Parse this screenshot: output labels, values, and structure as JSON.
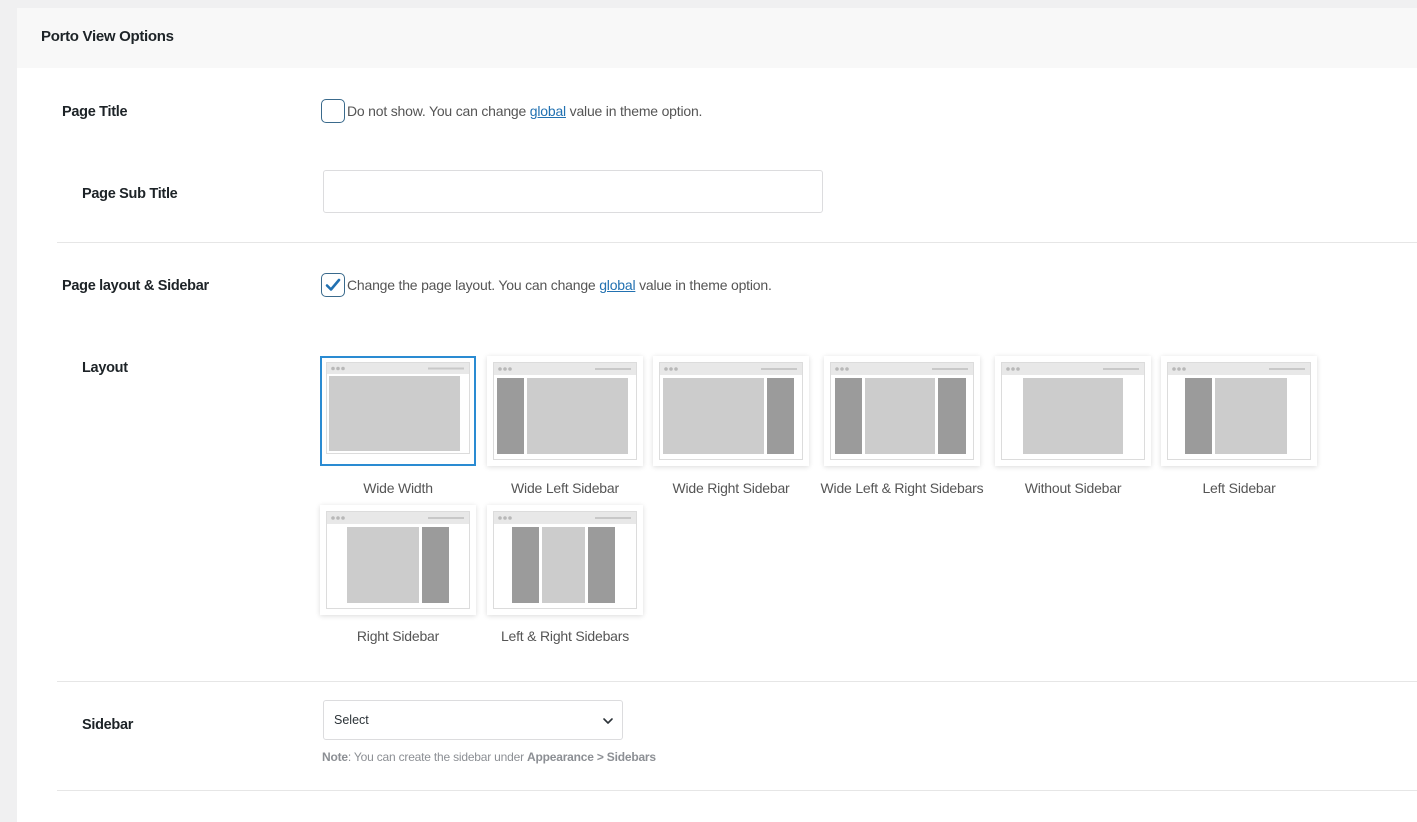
{
  "panel": {
    "title": "Porto View Options"
  },
  "page_title": {
    "label": "Page Title",
    "checked": false,
    "text_before": "Do not show. You can change ",
    "link": "global",
    "text_after": " value in theme option."
  },
  "page_sub_title": {
    "label": "Page Sub Title",
    "value": ""
  },
  "page_layout": {
    "label": "Page layout & Sidebar",
    "checked": true,
    "text_before": "Change the page layout. You can change ",
    "link": "global",
    "text_after": " value in theme option."
  },
  "layout": {
    "label": "Layout",
    "selected": "Wide Width",
    "options": [
      {
        "label": "Wide Width"
      },
      {
        "label": "Wide Left Sidebar"
      },
      {
        "label": "Wide Right Sidebar"
      },
      {
        "label": "Wide Left & Right Sidebars"
      },
      {
        "label": "Without Sidebar"
      },
      {
        "label": "Left Sidebar"
      },
      {
        "label": "Right Sidebar"
      },
      {
        "label": "Left & Right Sidebars"
      }
    ]
  },
  "sidebar": {
    "label": "Sidebar",
    "select_value": "Select",
    "note_prefix": "Note",
    "note_text": ": You can create the sidebar under ",
    "note_path": "Appearance > Sidebars"
  },
  "colors": {
    "accent": "#2a8bd2",
    "link": "#2271b1",
    "checkmark": "#2271b1"
  }
}
